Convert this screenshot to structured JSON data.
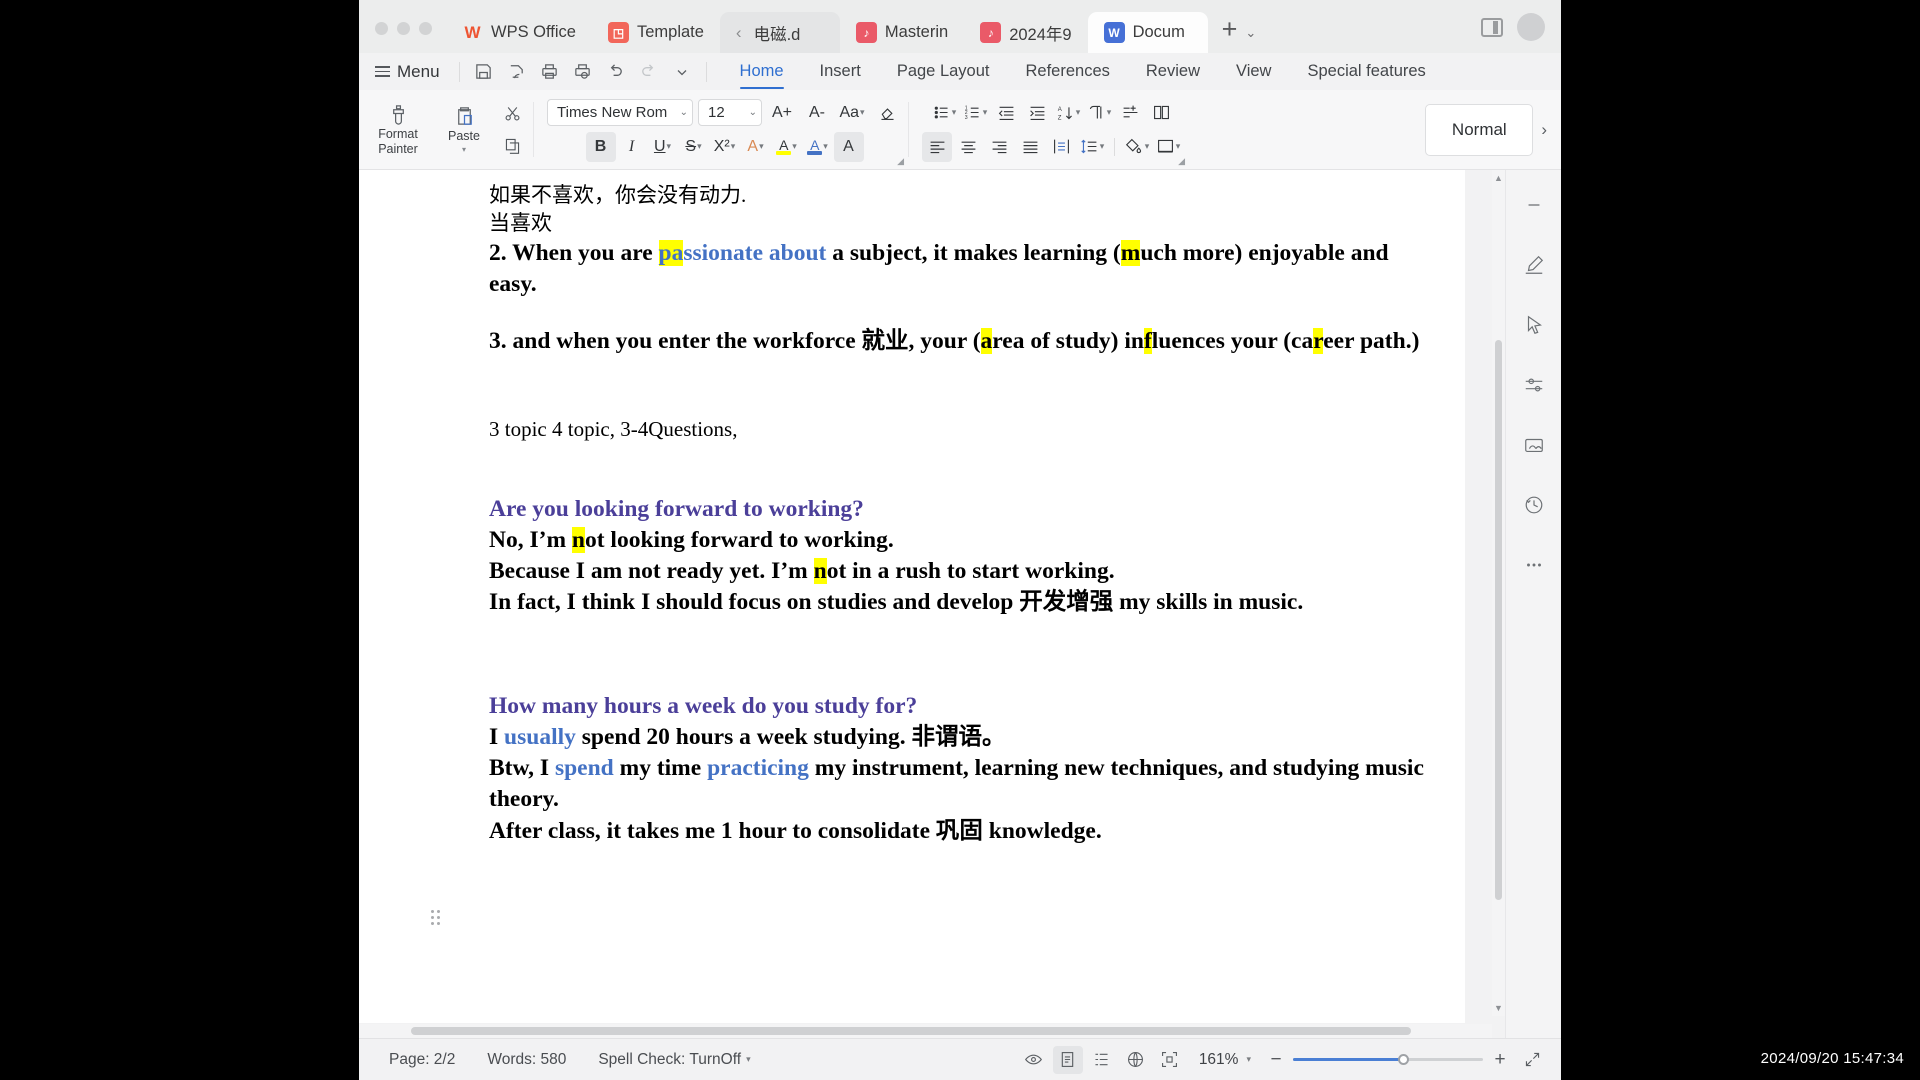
{
  "window": {
    "traffic_lights": [
      "close",
      "minimize",
      "maximize"
    ],
    "tabs": [
      {
        "id": "wps-office",
        "label": "WPS Office",
        "icon": "wps-logo-icon",
        "state": "inactive"
      },
      {
        "id": "template",
        "label": "Template",
        "icon": "template-icon",
        "state": "inactive"
      },
      {
        "id": "dianci",
        "label": "电磁.d",
        "icon": "back-chevron-icon",
        "state": "dim"
      },
      {
        "id": "mastering",
        "label": "Masterin",
        "icon": "presentation-icon",
        "state": "inactive"
      },
      {
        "id": "2024-sept",
        "label": "2024年9",
        "icon": "presentation-icon",
        "state": "inactive"
      },
      {
        "id": "document",
        "label": "Docum",
        "icon": "word-doc-icon",
        "state": "active"
      }
    ],
    "new_tab_label": "+"
  },
  "menubar": {
    "menu_label": "Menu",
    "quick_icons": [
      "save-icon",
      "save-as-icon",
      "print-icon",
      "print-preview-icon",
      "undo-icon",
      "redo-icon",
      "customize-chevron-icon"
    ],
    "ribbon_tabs": [
      {
        "id": "home",
        "label": "Home",
        "selected": true
      },
      {
        "id": "insert",
        "label": "Insert",
        "selected": false
      },
      {
        "id": "page-layout",
        "label": "Page Layout",
        "selected": false
      },
      {
        "id": "references",
        "label": "References",
        "selected": false
      },
      {
        "id": "review",
        "label": "Review",
        "selected": false
      },
      {
        "id": "view",
        "label": "View",
        "selected": false
      },
      {
        "id": "special-features",
        "label": "Special features",
        "selected": false
      }
    ]
  },
  "ribbon": {
    "format_painter": {
      "line1": "Format",
      "line2": "Painter"
    },
    "paste": {
      "label": "Paste"
    },
    "cut_icon": "scissors-icon",
    "copy_icon": "copy-icon",
    "font_name": {
      "value": "Times New Rom",
      "placeholder": "Font"
    },
    "font_size": {
      "value": "12",
      "placeholder": "Size"
    },
    "grow_font": "A+",
    "shrink_font": "A-",
    "change_case": "Aa",
    "clear_format": "clear-formatting-icon",
    "bold": "B",
    "italic": "I",
    "underline": "U",
    "strikethrough": "S",
    "superscript": "X²",
    "text_effects": "A",
    "highlight": "A",
    "font_color": "A",
    "char_shading": "A",
    "bullets_icon": "bullet-list-icon",
    "numbering_icon": "numbered-list-icon",
    "decrease_indent_icon": "decrease-indent-icon",
    "increase_indent_icon": "increase-indent-icon",
    "sort_icon": "sort-icon",
    "show_marks_icon": "paragraph-marks-icon",
    "merge_icon": "merge-icon",
    "columns_icon": "columns-icon",
    "align_left_icon": "align-left-icon",
    "align_center_icon": "align-center-icon",
    "align_right_icon": "align-right-icon",
    "align_justify_icon": "align-justify-icon",
    "distribute_icon": "distribute-icon",
    "line_spacing_icon": "line-spacing-icon",
    "shading_icon": "paragraph-shading-icon",
    "borders_icon": "borders-icon",
    "style_name": "Normal",
    "style_next": "›"
  },
  "document": {
    "paragraphs": [
      {
        "type": "cn",
        "runs": [
          {
            "text": "如果不喜欢，你会没有动力."
          }
        ]
      },
      {
        "type": "cn",
        "runs": [
          {
            "text": "当喜欢"
          }
        ]
      },
      {
        "type": "bd",
        "runs": [
          {
            "text": "2.  When you are "
          },
          {
            "text": "pa",
            "style": "blue-hl"
          },
          {
            "text": "ssionate about",
            "style": "blue"
          },
          {
            "text": " a subject, it makes learning ("
          },
          {
            "text": "m",
            "style": "hl"
          },
          {
            "text": "uch more) enjoyable and easy."
          }
        ]
      },
      {
        "type": "gap"
      },
      {
        "type": "bd",
        "runs": [
          {
            "text": "3.  and when you enter the workforce 就业, your ("
          },
          {
            "text": "a",
            "style": "hl"
          },
          {
            "text": "rea of study) in"
          },
          {
            "text": "f",
            "style": "hl"
          },
          {
            "text": "luences your (ca"
          },
          {
            "text": "r",
            "style": "hl"
          },
          {
            "text": "eer path.)"
          }
        ]
      },
      {
        "type": "gap2"
      },
      {
        "type": "plain",
        "runs": [
          {
            "text": "3 topic 4 topic,  3-4Questions,"
          }
        ]
      },
      {
        "type": "gap2"
      },
      {
        "type": "qh",
        "runs": [
          {
            "text": "Are you looking forward to working?"
          }
        ]
      },
      {
        "type": "bd",
        "runs": [
          {
            "text": "No, I’m "
          },
          {
            "text": "n",
            "style": "hl"
          },
          {
            "text": "ot looking forward to working."
          }
        ]
      },
      {
        "type": "bd",
        "runs": [
          {
            "text": "Because I am not ready yet.  I’m "
          },
          {
            "text": "n",
            "style": "hl"
          },
          {
            "text": "ot in a rush to start working."
          }
        ]
      },
      {
        "type": "bd",
        "runs": [
          {
            "text": "In fact, I think I should focus on studies and develop 开发增强 my skills in music."
          }
        ]
      },
      {
        "type": "gap3"
      },
      {
        "type": "qh",
        "runs": [
          {
            "text": "How many hours a week do you study for?"
          }
        ]
      },
      {
        "type": "bd",
        "runs": [
          {
            "text": "I "
          },
          {
            "text": "usually",
            "style": "blue"
          },
          {
            "text": " spend 20 hours a week studying. 非谓语。"
          }
        ]
      },
      {
        "type": "bd",
        "runs": [
          {
            "text": "Btw, I "
          },
          {
            "text": "spend",
            "style": "blue"
          },
          {
            "text": " my time "
          },
          {
            "text": "practicing",
            "style": "blue"
          },
          {
            "text": " my instrument, learning new techniques, and studying music theory."
          }
        ]
      },
      {
        "type": "bd",
        "runs": [
          {
            "text": "After class, it takes me 1 hour to consolidate 巩固 knowledge."
          }
        ]
      }
    ]
  },
  "rail": {
    "items": [
      {
        "id": "collapse",
        "icon": "minus-icon"
      },
      {
        "id": "pen",
        "icon": "pen-tool-icon"
      },
      {
        "id": "select",
        "icon": "cursor-arrow-icon"
      },
      {
        "id": "settings",
        "icon": "sliders-icon"
      },
      {
        "id": "picture",
        "icon": "image-tool-icon"
      },
      {
        "id": "history",
        "icon": "clock-history-icon"
      },
      {
        "id": "more",
        "icon": "more-dots-icon"
      }
    ]
  },
  "statusbar": {
    "page": "Page: 2/2",
    "words": "Words: 580",
    "spellcheck": "Spell Check: TurnOff",
    "view_icons": [
      "read-mode-icon",
      "page-view-icon",
      "outline-view-icon",
      "web-view-icon",
      "fullscreen-focus-icon"
    ],
    "zoom": "161%",
    "zoom_minus": "−",
    "zoom_plus": "+",
    "fullscreen_icon": "expand-icon"
  },
  "desktop": {
    "clock": "2024/09/20 15:47:34"
  },
  "colors": {
    "accent": "#2f6fd0",
    "heading_purple": "#4b3f99",
    "run_blue": "#4472c4",
    "highlight_yellow": "#ffff00",
    "window_bg": "#f2f2f3"
  }
}
